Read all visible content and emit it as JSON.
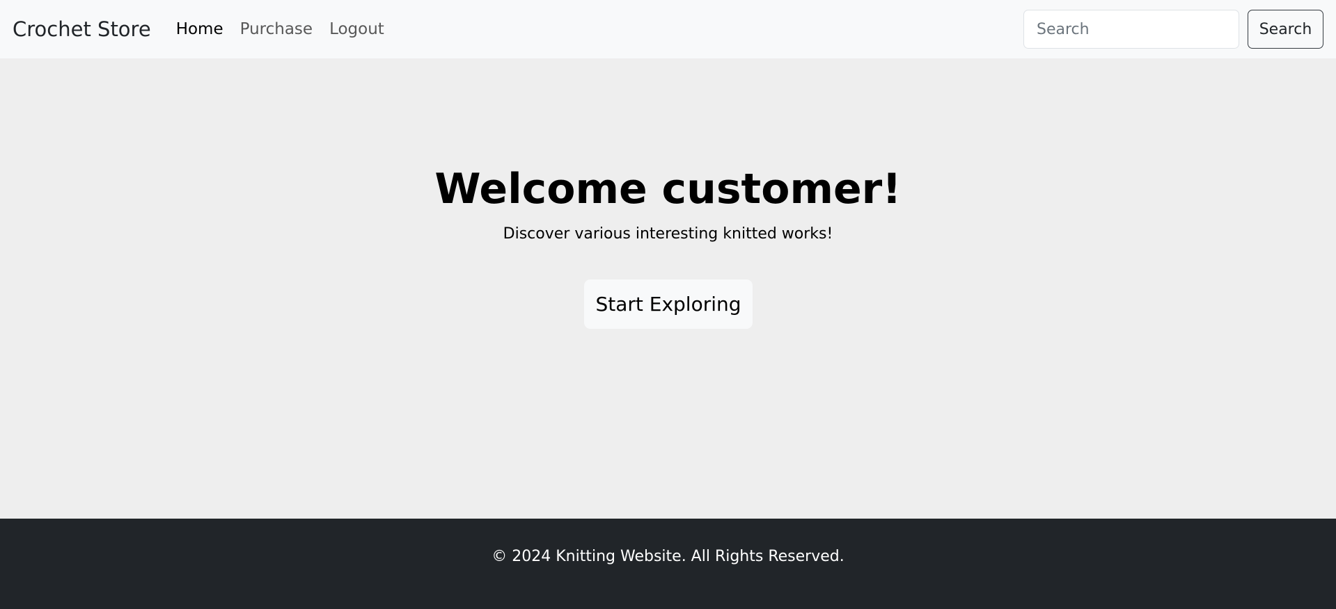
{
  "navbar": {
    "brand": "Crochet Store",
    "links": [
      {
        "label": "Home",
        "active": true
      },
      {
        "label": "Purchase",
        "active": false
      },
      {
        "label": "Logout",
        "active": false
      }
    ],
    "search": {
      "placeholder": "Search",
      "value": "",
      "button_label": "Search"
    }
  },
  "hero": {
    "title": "Welcome customer!",
    "subtitle": "Discover various interesting knitted works!",
    "cta_label": "Start Exploring"
  },
  "footer": {
    "text": "© 2024 Knitting Website. All Rights Reserved."
  },
  "colors": {
    "navbar_bg": "#f8f9fa",
    "page_bg": "#eeeeee",
    "footer_bg": "#212529"
  }
}
